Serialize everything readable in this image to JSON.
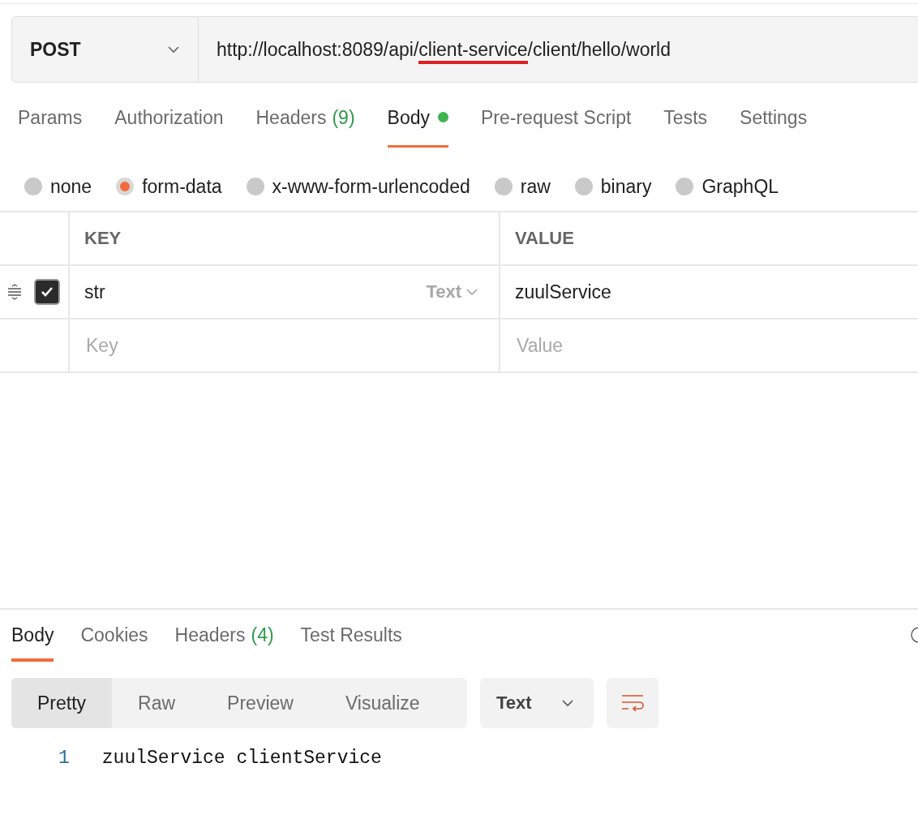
{
  "request": {
    "method": "POST",
    "url_parts": [
      {
        "text": "http://localhost:8089/api/",
        "marked": false
      },
      {
        "text": "client-service",
        "marked": true
      },
      {
        "text": "/client/hello/world",
        "marked": false
      }
    ]
  },
  "request_tabs": [
    {
      "label": "Params",
      "selected": false
    },
    {
      "label": "Authorization",
      "selected": false
    },
    {
      "label": "Headers",
      "count": "(9)",
      "selected": false
    },
    {
      "label": "Body",
      "selected": true,
      "indicator": true
    },
    {
      "label": "Pre-request Script",
      "selected": false
    },
    {
      "label": "Tests",
      "selected": false
    },
    {
      "label": "Settings",
      "selected": false
    }
  ],
  "body_types": [
    {
      "label": "none",
      "selected": false
    },
    {
      "label": "form-data",
      "selected": true
    },
    {
      "label": "x-www-form-urlencoded",
      "selected": false
    },
    {
      "label": "raw",
      "selected": false
    },
    {
      "label": "binary",
      "selected": false
    },
    {
      "label": "GraphQL",
      "selected": false
    }
  ],
  "params_table": {
    "columns": [
      "KEY",
      "VALUE"
    ],
    "rows": [
      {
        "key": "str",
        "type": "Text",
        "value": "zuulService",
        "checked": true
      }
    ],
    "new_row": {
      "key_placeholder": "Key",
      "value_placeholder": "Value"
    }
  },
  "response_tabs": [
    {
      "label": "Body",
      "selected": true
    },
    {
      "label": "Cookies",
      "selected": false
    },
    {
      "label": "Headers",
      "count": "(4)",
      "selected": false
    },
    {
      "label": "Test Results",
      "selected": false
    }
  ],
  "view_modes": [
    {
      "label": "Pretty",
      "selected": true
    },
    {
      "label": "Raw",
      "selected": false
    },
    {
      "label": "Preview",
      "selected": false
    },
    {
      "label": "Visualize",
      "selected": false
    }
  ],
  "format": "Text",
  "response_lines": [
    {
      "number": "1",
      "text": "zuulService clientService"
    }
  ]
}
